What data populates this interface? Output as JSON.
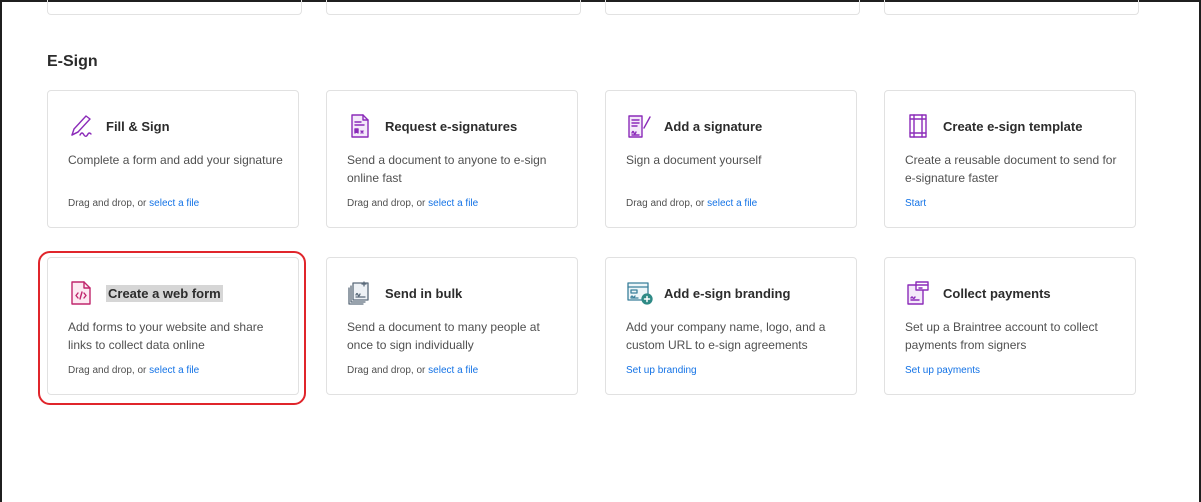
{
  "section": {
    "title": "E-Sign"
  },
  "colors": {
    "accent": "#1473e6",
    "icon": "#8b2bb9",
    "highlight": "#e0252b"
  },
  "cards": [
    {
      "title": "Fill & Sign",
      "icon": "fill-sign-icon",
      "desc": "Complete a form and add your signature",
      "action_prefix": "Drag and drop, or ",
      "action_link": "select a file"
    },
    {
      "title": "Request e-signatures",
      "icon": "request-signatures-icon",
      "desc": "Send a document to anyone to e-sign online fast",
      "action_prefix": "Drag and drop, or ",
      "action_link": "select a file"
    },
    {
      "title": "Add a signature",
      "icon": "add-signature-icon",
      "desc": "Sign a document yourself",
      "action_prefix": "Drag and drop, or ",
      "action_link": "select a file"
    },
    {
      "title": "Create e-sign template",
      "icon": "template-icon",
      "desc": "Create a reusable document to send for e-signature faster",
      "action_prefix": "",
      "action_link": "Start"
    },
    {
      "title": "Create a web form",
      "icon": "web-form-icon",
      "desc": "Add forms to your website and share links to collect data online",
      "action_prefix": "Drag and drop, or ",
      "action_link": "select a file"
    },
    {
      "title": "Send in bulk",
      "icon": "send-bulk-icon",
      "desc": "Send a document to many people at once to sign individually",
      "action_prefix": "Drag and drop, or ",
      "action_link": "select a file"
    },
    {
      "title": "Add e-sign branding",
      "icon": "branding-icon",
      "desc": "Add your company name, logo, and a custom URL to e-sign agreements",
      "action_prefix": "",
      "action_link": "Set up branding"
    },
    {
      "title": "Collect payments",
      "icon": "payments-icon",
      "desc": "Set up a Braintree account to collect payments from signers",
      "action_prefix": "",
      "action_link": "Set up payments"
    }
  ]
}
